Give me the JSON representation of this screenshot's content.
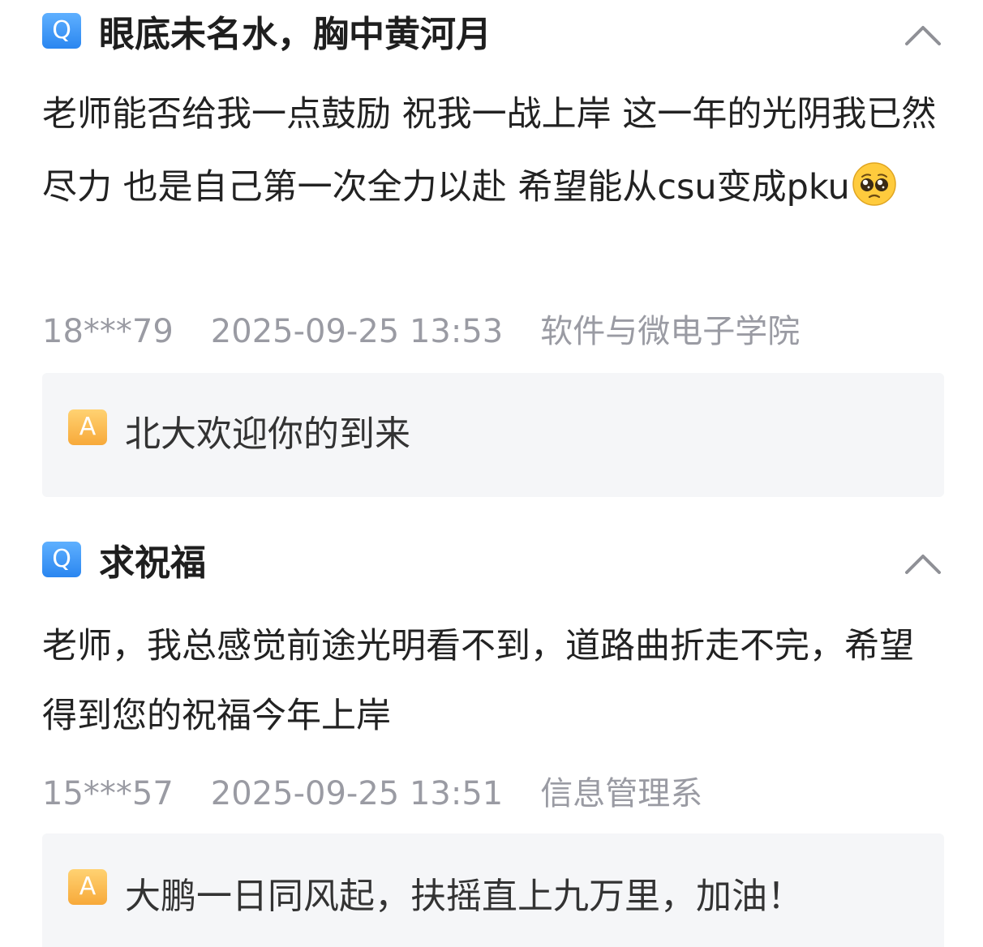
{
  "items": [
    {
      "q_badge": "Q",
      "title": "眼底未名水，胸中黄河月",
      "body": "老师能否给我一点鼓励 祝我一战上岸 这一年的光阴我已然尽力 也是自己第一次全力以赴 希望能从csu变成pku",
      "emoji_icon": "pleading-face-icon",
      "user": "18***79",
      "time": "2025-09-25 13:53",
      "dept": "软件与微电子学院",
      "a_badge": "A",
      "answer": "北大欢迎你的到来"
    },
    {
      "q_badge": "Q",
      "title": "求祝福",
      "body": "老师，我总感觉前途光明看不到，道路曲折走不完，希望得到您的祝福今年上岸",
      "user": "15***57",
      "time": "2025-09-25 13:51",
      "dept": "信息管理系",
      "a_badge": "A",
      "answer": "大鹏一日同风起，扶摇直上九万里，加油！"
    }
  ],
  "colors": {
    "q_badge": "#3d9bf8",
    "a_badge": "#f9b347",
    "meta_text": "#9a9ba3",
    "answer_bg": "#f5f6f8"
  }
}
